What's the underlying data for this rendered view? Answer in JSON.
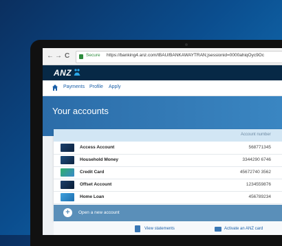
{
  "browser": {
    "back": "←",
    "forward": "→",
    "reload": "C",
    "secure_label": "Secure",
    "url": "https://banking4.anz.com/IBAU/BANKAWAYTRAN;jsessionid=0000ahiqOyc9Oc"
  },
  "brand": {
    "logo": "ANZ",
    "color": "#072946"
  },
  "subnav": {
    "items": [
      "Payments",
      "Profile",
      "Apply"
    ]
  },
  "page": {
    "title": "Your accounts"
  },
  "accounts_table": {
    "number_header": "Account number",
    "rows": [
      {
        "name": "Access Account",
        "number": "568771345"
      },
      {
        "name": "Household Money",
        "number": "3344290 6746"
      },
      {
        "name": "Credit Card",
        "number": "45672740 3562"
      },
      {
        "name": "Offset Account",
        "number": "1234559876"
      },
      {
        "name": "Home Loan",
        "number": "456789234"
      }
    ],
    "open_label": "Open a new account"
  },
  "actions": {
    "statements": "View statements",
    "activate": "Activate an ANZ card"
  }
}
